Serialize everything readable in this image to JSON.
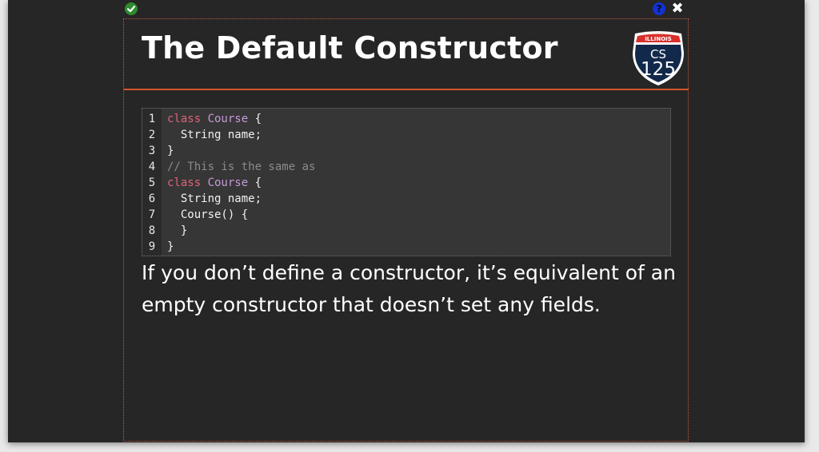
{
  "toolbar": {
    "status_icon": "check-icon",
    "help_icon": "question-icon",
    "help_label": "?",
    "close_label": "✖"
  },
  "slide": {
    "title": "The Default Constructor",
    "logo": {
      "top_text": "ILLINOIS",
      "line1": "CS",
      "line2": "125"
    },
    "code_lines": [
      {
        "number": "1",
        "parts": [
          {
            "t": "class ",
            "c": "kw"
          },
          {
            "t": "Course",
            "c": "cls"
          },
          {
            "t": " {",
            "c": ""
          }
        ]
      },
      {
        "number": "2",
        "parts": [
          {
            "t": "  String name;",
            "c": ""
          }
        ]
      },
      {
        "number": "3",
        "parts": [
          {
            "t": "}",
            "c": ""
          }
        ]
      },
      {
        "number": "4",
        "parts": [
          {
            "t": "// This is the same as",
            "c": "cm"
          }
        ]
      },
      {
        "number": "5",
        "parts": [
          {
            "t": "class ",
            "c": "kw"
          },
          {
            "t": "Course",
            "c": "cls"
          },
          {
            "t": " {",
            "c": ""
          }
        ]
      },
      {
        "number": "6",
        "parts": [
          {
            "t": "  String name;",
            "c": ""
          }
        ]
      },
      {
        "number": "7",
        "parts": [
          {
            "t": "  Course() {",
            "c": ""
          }
        ]
      },
      {
        "number": "8",
        "parts": [
          {
            "t": "  }",
            "c": ""
          }
        ]
      },
      {
        "number": "9",
        "parts": [
          {
            "t": "}",
            "c": ""
          }
        ]
      }
    ],
    "description": "If you don’t define a constructor, it’s equivalent of an empty constructor that doesn’t set any fields."
  },
  "colors": {
    "accent": "#d4542b",
    "keyword": "#e0637a",
    "class_name": "#c59bd8",
    "comment": "#8b8b8b"
  }
}
